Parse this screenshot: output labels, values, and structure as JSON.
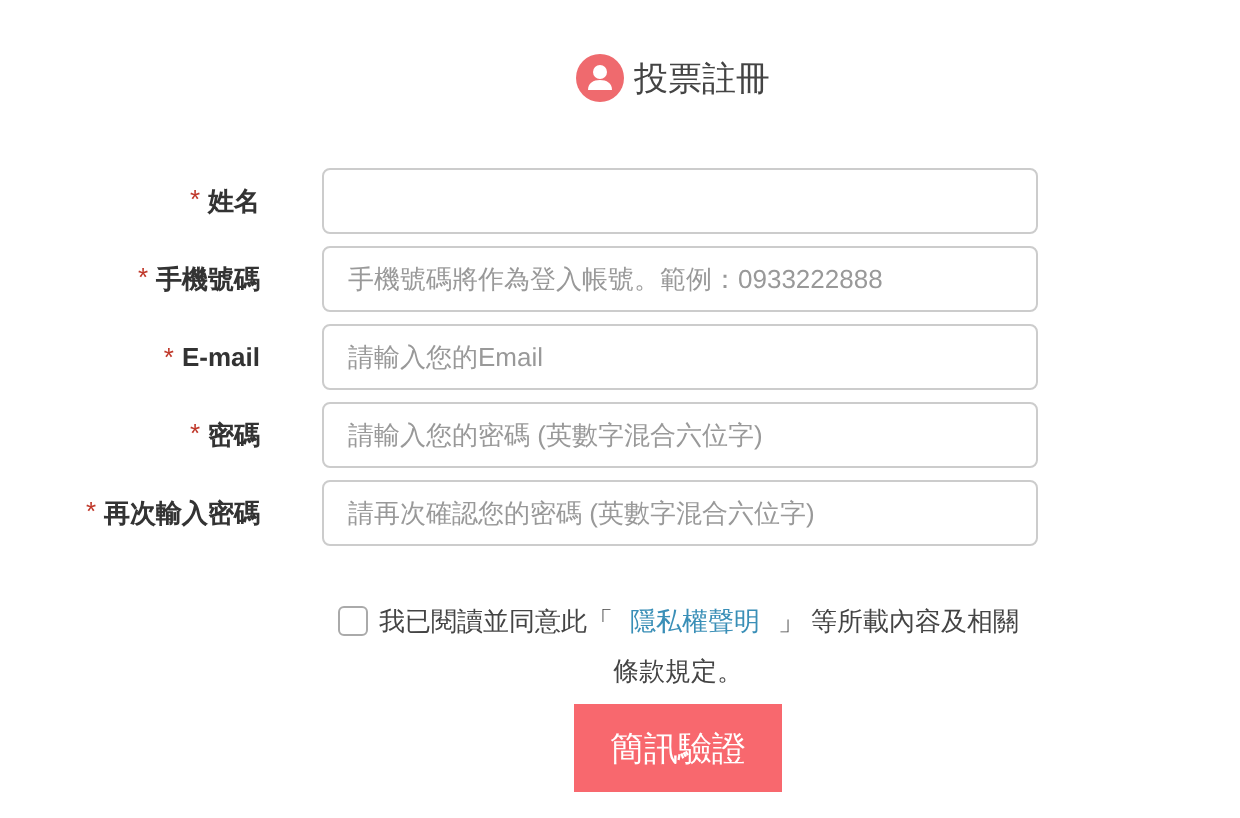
{
  "title": "投票註冊",
  "fields": [
    {
      "required_mark": "*",
      "label": "姓名"
    },
    {
      "required_mark": "*",
      "label": "手機號碼",
      "placeholder": "手機號碼將作為登入帳號。範例：0933222888"
    },
    {
      "required_mark": "*",
      "label": "E-mail",
      "placeholder": "請輸入您的Email"
    },
    {
      "required_mark": "*",
      "label": "密碼",
      "placeholder": "請輸入您的密碼 (英數字混合六位字)"
    },
    {
      "required_mark": "*",
      "label": "再次輸入密碼",
      "placeholder": "請再次確認您的密碼 (英數字混合六位字)"
    }
  ],
  "agreement": {
    "checked": false,
    "text_before": "我已閱讀並同意此「 ",
    "link": "隱私權聲明",
    "text_after": " 」 等所載內容及相關條款規定。"
  },
  "submit_button": "簡訊驗證"
}
